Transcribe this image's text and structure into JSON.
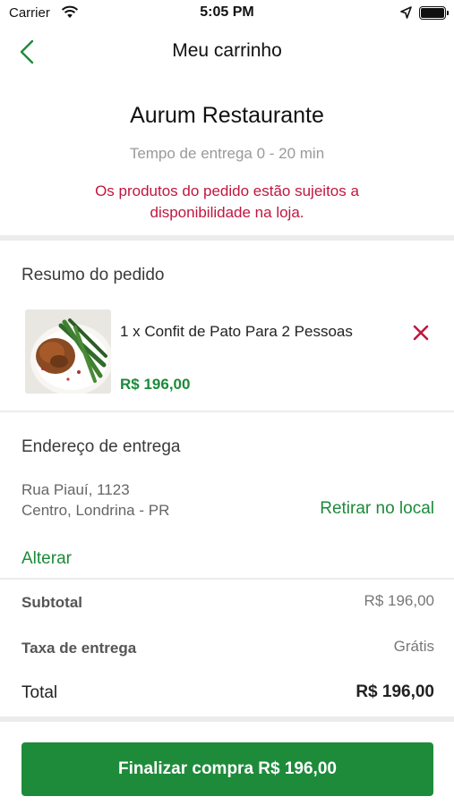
{
  "status_bar": {
    "carrier": "Carrier",
    "time": "5:05 PM"
  },
  "nav": {
    "title": "Meu carrinho",
    "back_icon": "chevron-left-icon"
  },
  "restaurant": {
    "name": "Aurum Restaurante",
    "delivery_time": "Tempo de entrega 0 - 20 min",
    "availability_line1": "Os produtos do pedido estão sujeitos a",
    "availability_line2": "disponibilidade na loja."
  },
  "order_summary": {
    "title": "Resumo do pedido",
    "items": [
      {
        "name": "1 x Confit de Pato Para 2 Pessoas",
        "price": "R$ 196,00",
        "remove_icon": "close-icon"
      }
    ]
  },
  "delivery_address": {
    "title": "Endereço de entrega",
    "line1": "Rua Piauí, 1123",
    "line2": "Centro, Londrina - PR",
    "pickup_label": "Retirar no local",
    "change_label": "Alterar"
  },
  "totals": {
    "subtotal_label": "Subtotal",
    "subtotal_value": "R$ 196,00",
    "fee_label": "Taxa de entrega",
    "fee_value": "Grátis",
    "total_label": "Total",
    "total_value": "R$ 196,00"
  },
  "checkout": {
    "label": "Finalizar compra R$ 196,00"
  },
  "colors": {
    "accent_green": "#1e8b3a",
    "warning_red": "#c0163f",
    "divider": "#ececec"
  }
}
